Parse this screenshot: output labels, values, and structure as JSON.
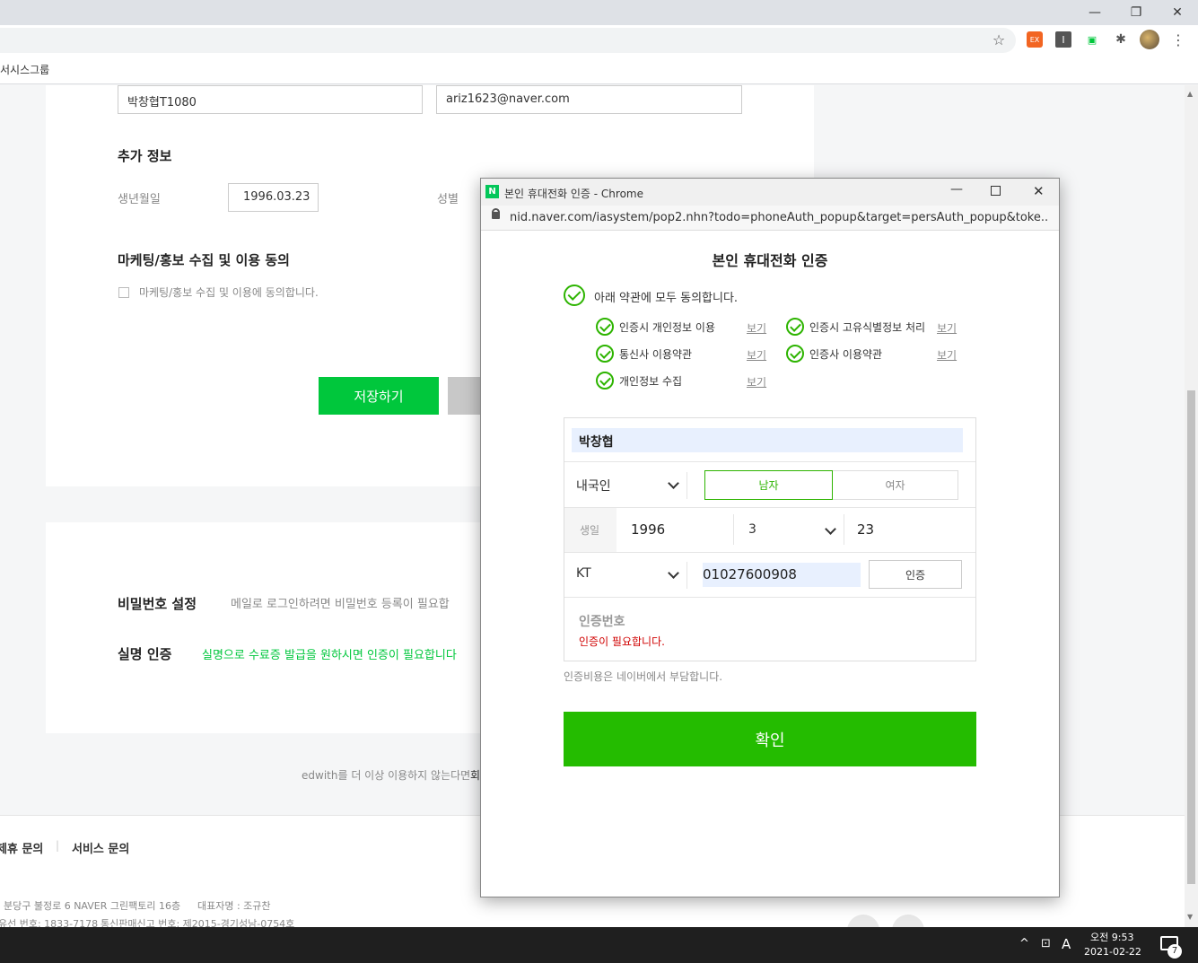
{
  "browser": {
    "bookmark_label": "서시스그룹",
    "window_icons": {
      "minimize": "—",
      "restore": "❐",
      "close": "✕"
    },
    "ext_labels": {
      "ext1": "EX",
      "ext2": "I",
      "ext3": "▣"
    }
  },
  "form": {
    "name_value": "박창협T1080",
    "email_value": "ariz1623@naver.com",
    "extra_title": "추가 정보",
    "birth_label": "생년월일",
    "birth_value": "1996.03.23",
    "gender_label": "성별",
    "marketing_title": "마케팅/홍보 수집 및 이용 동의",
    "marketing_checkbox_label": "마케팅/홍보 수집 및 이용에 동의합니다.",
    "save_button": "저장하기"
  },
  "settings": {
    "password_title": "비밀번호 설정",
    "password_desc": "메일로 로그인하려면 비밀번호 등록이 필요합",
    "realname_title": "실명 인증",
    "realname_desc": "실명으로 수료증 발급을 원하시면 인증이 필요합니다",
    "leave_text": "edwith를 더 이상 이용하지 않는다면",
    "leave_link": "회"
  },
  "footer": {
    "link1": "제휴 문의",
    "link2": "서비스 문의",
    "address": "분당구 불정로 6 NAVER 그린팩토리 16층",
    "ceo": "대표자명 : 조규찬",
    "phone": "유선 번호: 1833-7178",
    "license": "통신판매신고 번호: 제2015-경기성남-0754호"
  },
  "popup": {
    "window_title": "본인 휴대전화 인증 - Chrome",
    "favicon": "N",
    "url": "nid.naver.com/iasystem/pop2.nhn?todo=phoneAuth_popup&target=persAuth_popup&toke...",
    "heading": "본인 휴대전화 인증",
    "agree_all": "아래 약관에 모두 동의합니다.",
    "terms": [
      {
        "label": "인증시 개인정보 이용",
        "link": "보기"
      },
      {
        "label": "인증시 고유식별정보 처리",
        "link": "보기"
      },
      {
        "label": "통신사 이용약관",
        "link": "보기"
      },
      {
        "label": "인증사 이용약관",
        "link": "보기"
      },
      {
        "label": "개인정보 수집",
        "link": "보기"
      }
    ],
    "name_value": "박창협",
    "nationality": "내국인",
    "gender_male": "남자",
    "gender_female": "여자",
    "birth_label": "생일",
    "birth_year": "1996",
    "birth_month": "3",
    "birth_day": "23",
    "carrier": "KT",
    "phone_value": "01027600908",
    "auth_button": "인증",
    "code_label": "인증번호",
    "code_error": "인증이 필요합니다.",
    "cost_note": "인증비용은 네이버에서 부담합니다.",
    "confirm_button": "확인",
    "colors": {
      "accent_green": "#24bc00",
      "check_green": "#2db400",
      "error_red": "#d00000"
    }
  },
  "taskbar": {
    "ime": "A",
    "time": "오전 9:53",
    "date": "2021-02-22",
    "notifications": "7"
  }
}
